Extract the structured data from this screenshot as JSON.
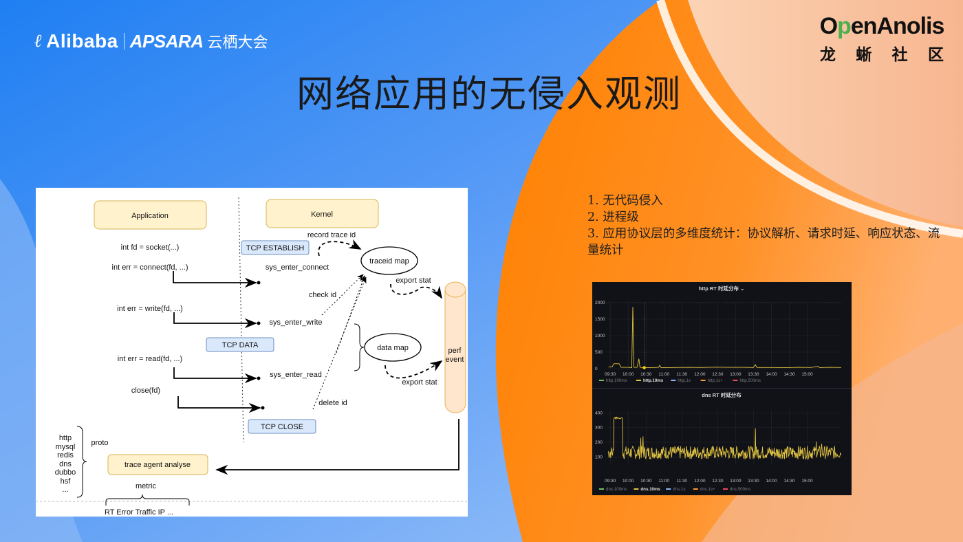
{
  "slide": {
    "title": "网络应用的无侵入观测",
    "brand_left": {
      "logo_glyph": "ℓ",
      "name": "Alibaba",
      "product": "APSARA",
      "event": "云栖大会"
    },
    "brand_right": {
      "name_prefix": "O",
      "name_p": "p",
      "name_suffix": "enAnolis",
      "cn": [
        "龙",
        "蜥",
        "社",
        "区"
      ]
    },
    "colors": {
      "blue": "#2f86f0",
      "orange": "#ff8a10",
      "peach": "#f7b98e"
    }
  },
  "bullets": [
    "1. 无代码侵入",
    "2. 进程级",
    "3. 应用协议层的多维度统计：协议解析、请求时延、响应状态、流量统计"
  ],
  "diagram": {
    "application_box": "Application",
    "kernel_box": "Kernel",
    "app_calls": [
      "int fd = socket(...)",
      "int err = connect(fd, ...)",
      "int err = write(fd, ...)",
      "int err = read(fd, ...)",
      "close(fd)"
    ],
    "tcp_states": [
      "TCP ESTABLISH",
      "TCP DATA",
      "TCP CLOSE"
    ],
    "syscalls": [
      "sys_enter_connect",
      "sys_enter_write",
      "sys_enter_read"
    ],
    "maps": [
      "traceid map",
      "data map"
    ],
    "edge_labels": {
      "record": "record trace id",
      "check": "check id",
      "delete": "delete id",
      "export1": "export stat",
      "export2": "export stat"
    },
    "perf_event": [
      "perf",
      "event"
    ],
    "protocols": [
      "http",
      "mysql",
      "redis",
      "dns",
      "dubbo",
      "hsf",
      "..."
    ],
    "proto_label": "proto",
    "agent_box": "trace agent analyse",
    "metric_label": "metric",
    "metrics": "RT Error Traffic IP ..."
  },
  "chart_data": [
    {
      "type": "line",
      "title": "http RT 时延分布",
      "title_suffix": "⌄",
      "ylim": [
        0,
        2000
      ],
      "yticks": [
        0,
        500,
        1000,
        1500,
        2000
      ],
      "xticks": [
        "09:30",
        "10:00",
        "10:30",
        "11:00",
        "11:30",
        "12:00",
        "12:30",
        "13:00",
        "13:30",
        "14:00",
        "14:30",
        "15:00"
      ],
      "xrange_hours": [
        9.42,
        15.95
      ],
      "grid": true,
      "legend": "bottom-left",
      "series": [
        {
          "name": "http.100ms",
          "color": "#73bf69",
          "points": []
        },
        {
          "name": "http.10ms",
          "color": "#e0c341",
          "highlighted": true,
          "points": [
            [
              9.45,
              50
            ],
            [
              9.55,
              50
            ],
            [
              9.6,
              150
            ],
            [
              9.75,
              150
            ],
            [
              9.8,
              40
            ],
            [
              10.0,
              40
            ],
            [
              10.1,
              30
            ],
            [
              10.13,
              1870
            ],
            [
              10.16,
              40
            ],
            [
              10.2,
              40
            ],
            [
              10.25,
              40
            ],
            [
              10.3,
              300
            ],
            [
              10.33,
              40
            ],
            [
              10.45,
              30
            ],
            [
              10.5,
              30
            ],
            [
              10.6,
              30
            ],
            [
              10.85,
              40
            ],
            [
              10.88,
              100
            ],
            [
              10.92,
              30
            ],
            [
              11.3,
              35
            ],
            [
              11.7,
              40
            ],
            [
              12.0,
              35
            ],
            [
              12.45,
              45
            ],
            [
              12.8,
              40
            ],
            [
              13.2,
              40
            ],
            [
              13.5,
              35
            ],
            [
              13.55,
              120
            ],
            [
              13.6,
              35
            ],
            [
              14.0,
              35
            ],
            [
              14.4,
              30
            ],
            [
              14.75,
              40
            ],
            [
              15.1,
              35
            ],
            [
              15.3,
              70
            ],
            [
              15.35,
              30
            ],
            [
              15.6,
              40
            ],
            [
              15.95,
              35
            ]
          ]
        },
        {
          "name": "http.1s",
          "color": "#8ab8ff",
          "points": []
        },
        {
          "name": "http.1s+",
          "color": "#ff9830",
          "points": []
        },
        {
          "name": "http.500ms",
          "color": "#f2495c",
          "points": []
        }
      ],
      "cursor_marker": {
        "x": 10.45,
        "y": 30
      }
    },
    {
      "type": "line",
      "title": "dns RT 时延分布",
      "ylim": [
        50,
        420
      ],
      "yticks": [
        100,
        200,
        300,
        400
      ],
      "xticks": [
        "09:30",
        "10:00",
        "10:30",
        "11:00",
        "11:30",
        "12:00",
        "12:30",
        "13:00",
        "13:30",
        "14:00",
        "14:30",
        "15:00"
      ],
      "xrange_hours": [
        9.42,
        15.95
      ],
      "grid": true,
      "legend": "bottom-left",
      "series": [
        {
          "name": "dns.100ms",
          "color": "#73bf69",
          "points": []
        },
        {
          "name": "dns.10ms",
          "color": "#e0c341",
          "highlighted": true,
          "baseline": 130,
          "noise": 45,
          "plateau": {
            "from": 9.6,
            "to": 9.85,
            "value": 365
          },
          "spikes": [
            [
              10.35,
              230
            ],
            [
              10.42,
              240
            ],
            [
              13.55,
              295
            ],
            [
              15.25,
              205
            ],
            [
              15.4,
              190
            ]
          ]
        },
        {
          "name": "dns.1s",
          "color": "#8ab8ff",
          "points": []
        },
        {
          "name": "dns.1s+",
          "color": "#ff9830",
          "points": []
        },
        {
          "name": "dns.500ms",
          "color": "#f2495c",
          "points": []
        }
      ]
    }
  ]
}
